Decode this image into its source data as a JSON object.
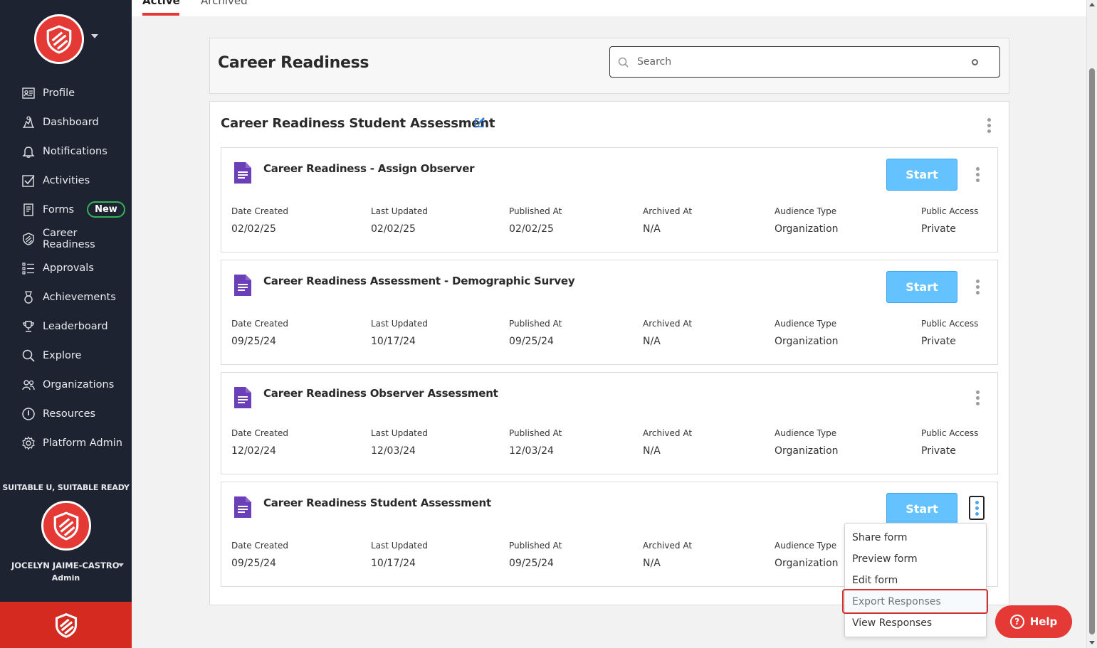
{
  "colors": {
    "sidebar_bg": "#1d2330",
    "brand_red": "#e53935",
    "start_blue": "#64c2ff",
    "badge_green": "#34b25a",
    "form_icon_purple": "#6b3fb8"
  },
  "tabs": {
    "active": "Active",
    "archived": "Archived"
  },
  "sidebar": {
    "items": [
      {
        "label": "Profile",
        "icon": "profile-card-icon"
      },
      {
        "label": "Dashboard",
        "icon": "dashboard-icon"
      },
      {
        "label": "Notifications",
        "icon": "bell-icon"
      },
      {
        "label": "Activities",
        "icon": "checkbox-icon"
      },
      {
        "label": "Forms",
        "icon": "forms-icon",
        "badge": "New"
      },
      {
        "label": "Career Readiness",
        "icon": "shield-stripes-icon"
      },
      {
        "label": "Approvals",
        "icon": "list-check-icon"
      },
      {
        "label": "Achievements",
        "icon": "medal-icon"
      },
      {
        "label": "Leaderboard",
        "icon": "trophy-icon"
      },
      {
        "label": "Explore",
        "icon": "explore-search-icon"
      },
      {
        "label": "Organizations",
        "icon": "people-icon"
      },
      {
        "label": "Resources",
        "icon": "info-circle-icon"
      },
      {
        "label": "Platform Admin",
        "icon": "gear-icon"
      }
    ],
    "org_name": "SUITABLE U, SUITABLE READY",
    "user_name": "JOCELYN JAIME-CASTRO",
    "user_role": "Admin"
  },
  "header": {
    "title": "Career Readiness",
    "search_placeholder": "Search"
  },
  "group": {
    "title": "Career Readiness Student Assessment"
  },
  "meta_labels": {
    "date_created": "Date Created",
    "last_updated": "Last Updated",
    "published_at": "Published At",
    "archived_at": "Archived At",
    "audience_type": "Audience Type",
    "public_access": "Public Access"
  },
  "start_label": "Start",
  "forms": [
    {
      "title": "Career Readiness - Assign Observer",
      "has_start": true,
      "date_created": "02/02/25",
      "last_updated": "02/02/25",
      "published_at": "02/02/25",
      "archived_at": "N/A",
      "audience_type": "Organization",
      "public_access": "Private"
    },
    {
      "title": "Career Readiness Assessment - Demographic Survey",
      "has_start": true,
      "date_created": "09/25/24",
      "last_updated": "10/17/24",
      "published_at": "09/25/24",
      "archived_at": "N/A",
      "audience_type": "Organization",
      "public_access": "Private"
    },
    {
      "title": "Career Readiness Observer Assessment",
      "has_start": false,
      "date_created": "12/02/24",
      "last_updated": "12/03/24",
      "published_at": "12/03/24",
      "archived_at": "N/A",
      "audience_type": "Organization",
      "public_access": "Private"
    },
    {
      "title": "Career Readiness Student Assessment",
      "has_start": true,
      "date_created": "09/25/24",
      "last_updated": "10/17/24",
      "published_at": "09/25/24",
      "archived_at": "N/A",
      "audience_type": "Organization",
      "public_access": ""
    }
  ],
  "menu": {
    "items": [
      "Share form",
      "Preview form",
      "Edit form",
      "Export Responses",
      "View Responses"
    ],
    "highlighted": "Export Responses"
  },
  "help": {
    "label": "Help"
  }
}
